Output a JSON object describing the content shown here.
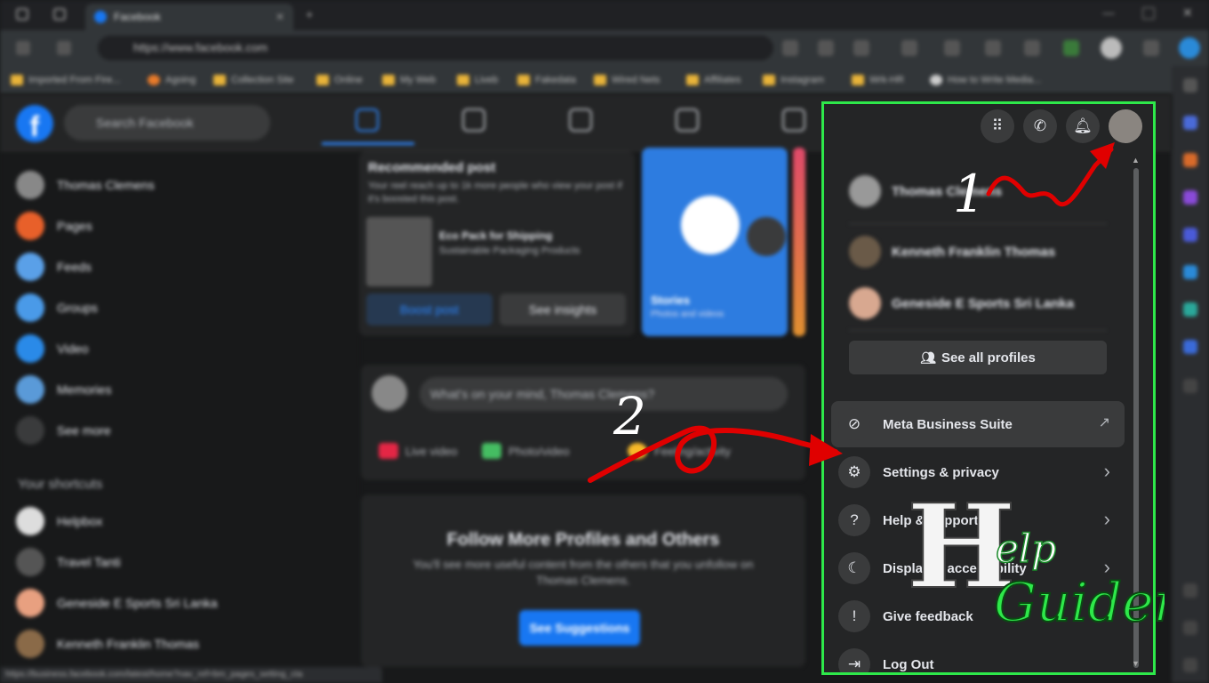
{
  "browser": {
    "tab_title": "Facebook",
    "url": "https://www.facebook.com",
    "bookmarks": [
      "Imported From Fire...",
      "Agoing",
      "Collection Site",
      "Online",
      "My Web",
      "Liveb",
      "Fakedata",
      "Wired Nets",
      "Affiliates",
      "Instagram",
      "Wrk-HR",
      "How to Write Media..."
    ]
  },
  "facebook": {
    "search_placeholder": "Search Facebook",
    "left_nav": [
      "Thomas Clemens",
      "Pages",
      "Feeds",
      "Groups",
      "Video",
      "Memories",
      "See more"
    ],
    "shortcuts_header": "Your shortcuts",
    "shortcuts": [
      "Helpbox",
      "Travel Tanti",
      "Geneside E Sports Sri Lanka",
      "Kenneth Franklin Thomas"
    ],
    "recommended_post": {
      "heading": "Recommended post",
      "body": "Your reel reach up to 1k more people who view your post if it's boosted this post.",
      "post_title": "Eco Pack for Shipping",
      "post_sub": "Sustainable Packaging Products",
      "boost_label": "Boost post",
      "insights_label": "See insights"
    },
    "story_label": "Stories",
    "story_sub": "Photos and videos",
    "composer_placeholder": "What's on your mind, Thomas Clemens?",
    "composer_actions": [
      "Live video",
      "Photo/video",
      "Feeling/activity"
    ],
    "follow_card": {
      "title": "Follow More Profiles and Others",
      "body": "You'll see more useful content from the others that you unfollow on Thomas Clemens.",
      "button": "See Suggestions"
    },
    "status_url": "https://business.facebook.com/latest/home?nav_ref=bm_pages_setting_cta"
  },
  "menu": {
    "profiles": [
      "Thomas Clemens",
      "Kenneth Franklin Thomas",
      "Geneside E Sports Sri Lanka"
    ],
    "see_all_profiles": "See all profiles",
    "items": [
      {
        "label": "Meta Business Suite",
        "icon": "meta-business-icon",
        "trailing": "external-link-icon"
      },
      {
        "label": "Settings & privacy",
        "icon": "gear-icon",
        "trailing": "chevron-right-icon"
      },
      {
        "label": "Help & support",
        "icon": "question-icon",
        "trailing": "chevron-right-icon"
      },
      {
        "label": "Display & accessibility",
        "icon": "moon-icon",
        "trailing": "chevron-right-icon"
      },
      {
        "label": "Give feedback",
        "icon": "feedback-icon",
        "trailing": ""
      },
      {
        "label": "Log Out",
        "icon": "logout-icon",
        "trailing": ""
      }
    ]
  },
  "annotations": {
    "step1": "1",
    "step2": "2"
  },
  "watermark": {
    "text": "Help Guider"
  },
  "colors": {
    "highlight_border": "#2ee84a",
    "arrow": "#e00000",
    "fb_blue": "#1877f2"
  }
}
